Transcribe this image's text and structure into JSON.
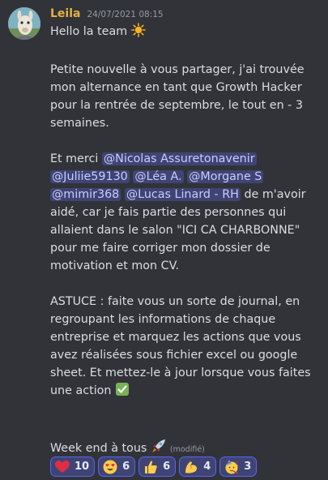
{
  "message": {
    "username": "Leila",
    "timestamp": "24/07/2021 08:15",
    "greeting": "Hello la team",
    "paragraph1": "Petite nouvelle à vous partager, j'ai trouvée mon alternance en tant que Growth Hacker pour la rentrée de septembre, le tout en - 3 semaines.",
    "thanks_prefix": "Et merci ",
    "mentions": [
      "@Nicolas Assuretonavenir",
      "@Juliie59130",
      "@Léa A.",
      "@Morgane S",
      "@mimir368",
      "@Lucas Linard - RH"
    ],
    "thanks_suffix": " de m'avoir aidé, car je fais partie des personnes qui allaient dans le salon \"ICI CA CHARBONNE\" pour me faire corriger mon dossier de motivation et mon CV.",
    "tip": "ASTUCE : faite vous un sorte de journal, en regroupant les informations de chaque entreprise et marquez les actions que vous avez réalisées sous fichier excel ou google sheet. Et mettez-le à jour lorsque vous faites une action",
    "closing": "Week end à tous",
    "edited": "(modifié)"
  },
  "reactions": [
    {
      "icon": "heart-icon",
      "count": "10"
    },
    {
      "icon": "heart-eyes-icon",
      "count": "6"
    },
    {
      "icon": "thumbs-up-icon",
      "count": "6"
    },
    {
      "icon": "flexed-biceps-icon",
      "count": "4"
    },
    {
      "icon": "partying-face-icon",
      "count": "3"
    }
  ],
  "colors": {
    "background": "#323339",
    "username": "#e3b341",
    "mention_bg": "#3f4475",
    "reaction_border": "#5865f2"
  }
}
